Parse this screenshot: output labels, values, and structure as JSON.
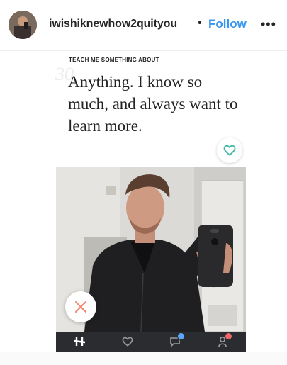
{
  "post_header": {
    "username": "iwishiknewhow2quityou",
    "separator": "•",
    "follow_label": "Follow",
    "more_label": "•••"
  },
  "hinge_card": {
    "prompt": "TEACH ME SOMETHING ABOUT",
    "watermark": "30",
    "answer": "Anything. I know so much, and always want to learn more.",
    "like_icon": "heart-outline-icon",
    "reject_icon": "x-icon"
  },
  "tab_bar": {
    "tabs": [
      {
        "icon": "hinge-logo-icon"
      },
      {
        "icon": "heart-icon"
      },
      {
        "icon": "chat-bubble-icon",
        "badge": "2"
      },
      {
        "icon": "person-icon",
        "badge": "1"
      }
    ]
  },
  "colors": {
    "follow": "#3897f0",
    "heart_teal": "#3fb9a6",
    "reject_coral": "#f0876f",
    "tab_bar": "#2b2c30"
  }
}
